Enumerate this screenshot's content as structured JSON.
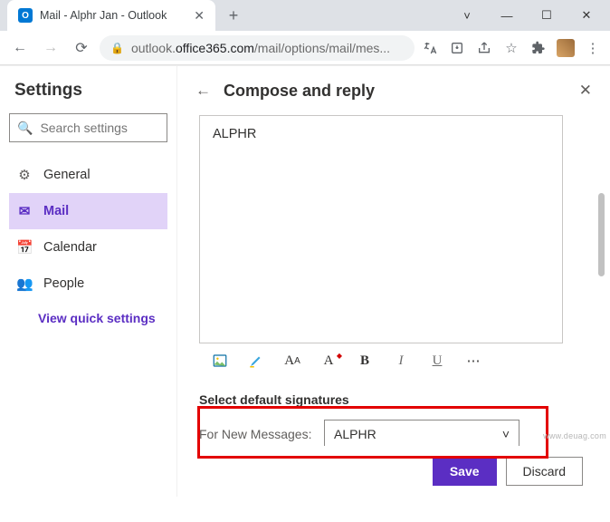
{
  "window": {
    "tab_title": "Mail - Alphr Jan - Outlook",
    "url_prefix": "outlook.",
    "url_domain": "office365.com",
    "url_path": "/mail/options/mail/mes..."
  },
  "sidebar": {
    "title": "Settings",
    "search_placeholder": "Search settings",
    "items": [
      {
        "icon": "⚙",
        "label": "General"
      },
      {
        "icon": "✉",
        "label": "Mail"
      },
      {
        "icon": "📅",
        "label": "Calendar"
      },
      {
        "icon": "👥",
        "label": "People"
      }
    ],
    "quick_link": "View quick settings"
  },
  "main": {
    "title": "Compose and reply",
    "editor_text": "ALPHR",
    "section_heading": "Select default signatures",
    "new_messages_label": "For New Messages:",
    "new_messages_value": "ALPHR",
    "save_label": "Save",
    "discard_label": "Discard"
  },
  "toolbar": {
    "image": "image-icon",
    "highlight": "highlighter-icon",
    "font": "font-size-icon",
    "font_color": "font-color-icon",
    "bold": "B",
    "italic": "I",
    "underline": "U",
    "more": "⋯"
  },
  "watermark": "www.deuag.com"
}
